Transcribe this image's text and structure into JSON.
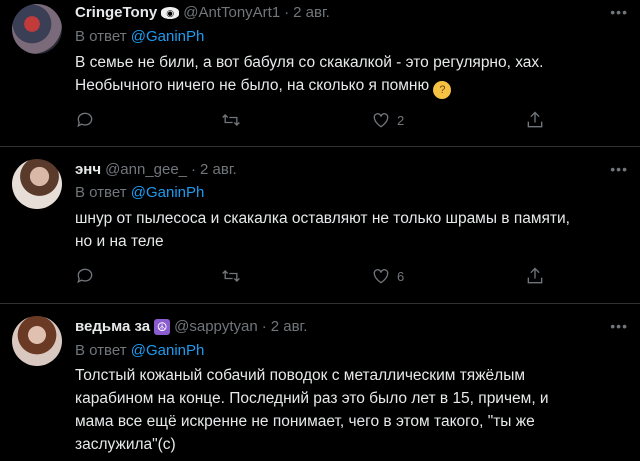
{
  "tweets": [
    {
      "name": "CringeTony",
      "badge": "eye-badge",
      "handle": "@AntTonyArt1",
      "sep": "·",
      "date": "2 авг.",
      "reply_prefix": "В ответ",
      "reply_to": "@GaninPh",
      "text_line1": "В семье не били, а вот бабуля со скакалкой - это регулярно, хах.",
      "text_line2": "Необычного ничего не было, на сколько я помню",
      "emoji": "thinking-face",
      "likes": "2"
    },
    {
      "name": "энч",
      "handle": "@ann_gee_",
      "sep": "·",
      "date": "2 авг.",
      "reply_prefix": "В ответ",
      "reply_to": "@GaninPh",
      "text_line1": "шнур от пылесоса и скакалка оставляют не только шрамы в памяти,",
      "text_line2": "но и на теле",
      "likes": "6"
    },
    {
      "name": "ведьма за",
      "badge": "peace-badge",
      "handle": "@sappytyan",
      "sep": "·",
      "date": "2 авг.",
      "reply_prefix": "В ответ",
      "reply_to": "@GaninPh",
      "text_line1": "Толстый кожаный собачий поводок с металлическим тяжёлым",
      "text_line2": "карабином на конце. Последний раз это было лет в 15, причем, и",
      "text_line3": "мама все ещё искренне не понимает, чего в этом такого, \"ты же",
      "text_line4": "заслужила\"(с)"
    }
  ],
  "colors": {
    "background": "#000000",
    "text": "#e7e9ea",
    "muted": "#71767b",
    "link": "#1d9bf0",
    "divider": "#2f3336"
  }
}
